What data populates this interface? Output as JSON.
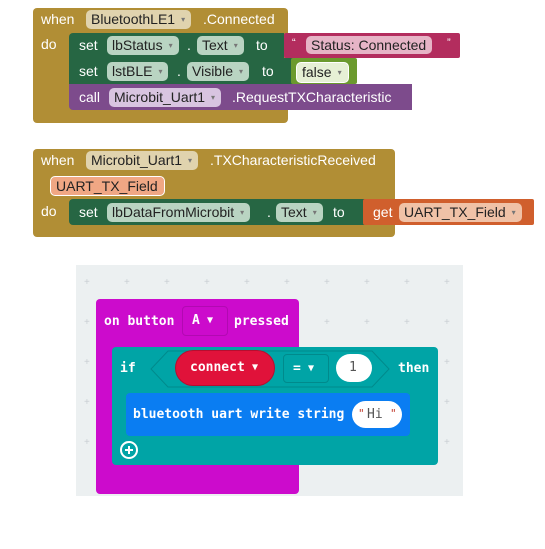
{
  "app_inventor": {
    "block1": {
      "when_label": "when",
      "component": "BluetoothLE1",
      "event": ".Connected",
      "do_label": "do",
      "statements": [
        {
          "kind": "set",
          "set_label": "set",
          "component": "lbStatus",
          "dot": ".",
          "property": "Text",
          "to_label": "to",
          "value": {
            "type": "string",
            "open_quote": "“",
            "text": "Status: Connected",
            "close_quote": "”"
          }
        },
        {
          "kind": "set",
          "set_label": "set",
          "component": "lstBLE",
          "dot": ".",
          "property": "Visible",
          "to_label": "to",
          "value": {
            "type": "boolean",
            "text": "false"
          }
        },
        {
          "kind": "call",
          "call_label": "call",
          "component": "Microbit_Uart1",
          "method": ".RequestTXCharacteristic"
        }
      ]
    },
    "block2": {
      "when_label": "when",
      "component": "Microbit_Uart1",
      "event": ".TXCharacteristicReceived",
      "param": "UART_TX_Field",
      "do_label": "do",
      "statement": {
        "set_label": "set",
        "component": "lbDataFromMicrobit",
        "dot": ".",
        "property": "Text",
        "to_label": "to",
        "get_label": "get",
        "get_var": "UART_TX_Field"
      }
    },
    "dropdown_glyph": "▾"
  },
  "makecode": {
    "event": {
      "prefix": "on button",
      "button": "A",
      "suffix": "pressed"
    },
    "if_block": {
      "if_label": "if",
      "variable": "connect",
      "operator": "=",
      "value": "1",
      "then_label": "then"
    },
    "statement": {
      "text": "bluetooth uart write string",
      "string_value": "Hi",
      "quote": "\""
    },
    "add_icon": "plus-circle-icon",
    "dropdown_glyph": "▼",
    "colors": {
      "event": "#cc0bcc",
      "logic": "#00a4a6",
      "bluetooth": "#0a7df2",
      "variable": "#e0123a"
    }
  }
}
